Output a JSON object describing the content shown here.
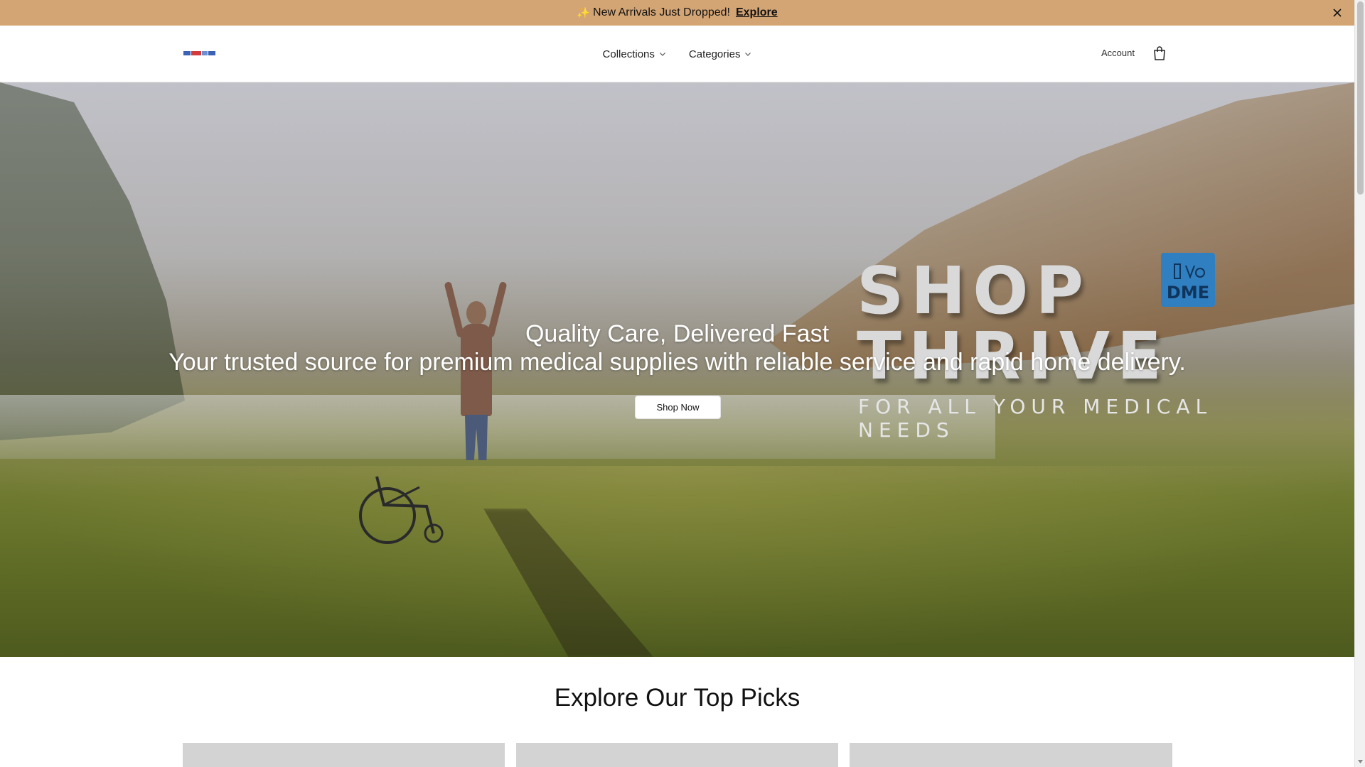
{
  "announcement": {
    "sparkle": "✨",
    "text": "New Arrivals Just Dropped!",
    "link": "Explore"
  },
  "header": {
    "nav": [
      {
        "label": "Collections"
      },
      {
        "label": "Categories"
      }
    ],
    "account_label": "Account"
  },
  "hero": {
    "brand_shop": "SHOP",
    "brand_thrive": "THRIVE",
    "brand_badge": "DME",
    "brand_tagline": "FOR ALL YOUR MEDICAL NEEDS",
    "title": "Quality Care, Delivered Fast",
    "subtitle": "Your trusted source for premium medical supplies with reliable service and rapid home delivery.",
    "cta": "Shop Now"
  },
  "section": {
    "title": "Explore Our Top Picks"
  },
  "colors": {
    "announcement_bg": "#d4a574",
    "badge_blue": "#2f7fc1"
  }
}
